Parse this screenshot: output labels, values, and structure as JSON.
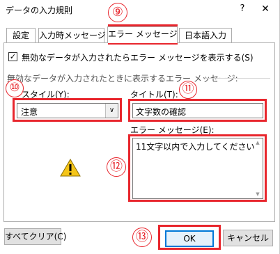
{
  "window": {
    "title": "データの入力規則",
    "help_label": "?",
    "close_label": "✕"
  },
  "tabs": [
    {
      "label": "設定"
    },
    {
      "label": "入力時メッセージ"
    },
    {
      "label": "エラー メッセージ"
    },
    {
      "label": "日本語入力"
    }
  ],
  "error_tab": {
    "show_alert_checkbox": {
      "checked": true,
      "check_glyph": "✓",
      "label": "無効なデータが入力されたらエラー メッセージを表示する(S)"
    },
    "group_label": "無効なデータが入力されたときに表示するエラー メッセージ:",
    "style_label": "スタイル(Y):",
    "style_value": "注意",
    "style_arrow": "∨",
    "title_label": "タイトル(T):",
    "title_value": "文字数の確認",
    "message_label": "エラー メッセージ(E):",
    "message_value": "11文字以内で入力してください",
    "icon": "warning-triangle-icon"
  },
  "footer": {
    "clear_all_label": "すべてクリア(C)",
    "ok_label": "OK",
    "cancel_label": "キャンセル"
  },
  "annotations": [
    {
      "number": "⑨"
    },
    {
      "number": "⑩"
    },
    {
      "number": "⑪"
    },
    {
      "number": "⑫"
    },
    {
      "number": "⑬"
    }
  ],
  "colors": {
    "annotation_red": "#e8262d",
    "default_button_border": "#0078d7",
    "warning_yellow": "#f5c518"
  }
}
